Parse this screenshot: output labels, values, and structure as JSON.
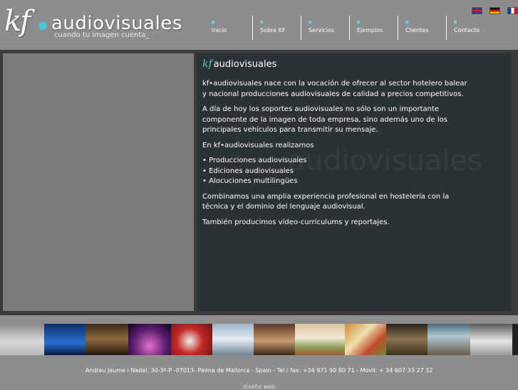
{
  "header": {
    "logo": {
      "kf": "kf",
      "word": "audiovisuales",
      "tagline": "cuando tu imagen cuenta_"
    },
    "nav": [
      {
        "label": "Inicio"
      },
      {
        "label": "Sobre KF"
      },
      {
        "label": "Servicios"
      },
      {
        "label": "Ejemplos"
      },
      {
        "label": "Clientes"
      },
      {
        "label": "Contacto"
      }
    ],
    "flags": [
      "english-flag-icon",
      "german-flag-icon",
      "french-flag-icon"
    ]
  },
  "main": {
    "title_kf": "kf",
    "title_word": "audiovisuales",
    "watermark": "audiovisuales",
    "paragraphs": [
      "kf•audiovisuales nace con la vocación de ofrecer al sector hotelero balear y nacional producciones audiovisuales de calidad a precios competitivos.",
      "A día de hoy los soportes audiovisuales no sólo son un importante componente de la imagen de toda empresa, sino además uno de los principales vehículos para transmitir su mensaje.",
      "En kf•audiovisuales realizamos"
    ],
    "services": [
      "• Producciones audiovisuales",
      "• Ediciones audiovisuales",
      "• Alocuciones multilingües"
    ],
    "closing": [
      "Combinamos una amplia experiencia profesional en hostelería con la técnica y el dominio del lenguaje audiovisual.",
      "También producimos vídeo-currículums y reportajes."
    ]
  },
  "colors": {
    "background": "#8d8d8d",
    "content_bg": "#2a3234",
    "accent": "#5fc0d4"
  },
  "footer": {
    "address": "Andreu Jaume i Nadal, 30-3º-P -07013- Palma de Mallorca - Spain - Tel / fax: +34 971 90 80 71 - Movil: + 34 607 33 27 32",
    "credit": "diseño web"
  }
}
